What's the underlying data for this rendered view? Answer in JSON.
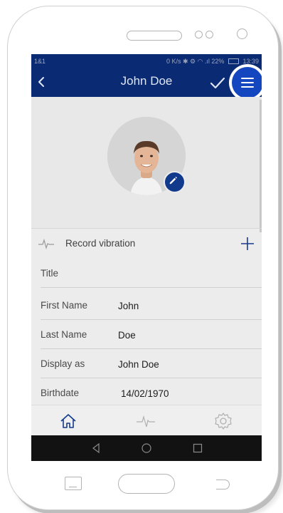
{
  "status_bar": {
    "carrier": "1&1",
    "indicators": "0 K/s ✱ ⚙ ◠ .ıl 22%",
    "time": "13:39"
  },
  "app_bar": {
    "title": "John Doe",
    "back_icon": "chevron-left-icon",
    "save_icon": "check-icon",
    "menu_icon": "hamburger-menu-icon"
  },
  "profile": {
    "avatar": "avatar",
    "edit_icon": "pencil-icon"
  },
  "record": {
    "label": "Record vibration",
    "icon": "waveform-icon",
    "add_icon": "plus-icon"
  },
  "fields": [
    {
      "label": "Title",
      "value": ""
    },
    {
      "label": "First Name",
      "value": "John"
    },
    {
      "label": "Last Name",
      "value": "Doe"
    },
    {
      "label": "Display as",
      "value": "John Doe"
    },
    {
      "label": "Birthdate",
      "value": "14/02/1970"
    }
  ],
  "bottom_nav": [
    "home-icon",
    "waveform-icon",
    "gear-icon"
  ],
  "system_nav": [
    "back-triangle-icon",
    "home-circle-icon",
    "recents-square-icon"
  ],
  "colors": {
    "app_bar": "#0a2b73",
    "accent": "#1446c0",
    "nav_active": "#123a8c",
    "overlay_dim": "#ececec"
  }
}
